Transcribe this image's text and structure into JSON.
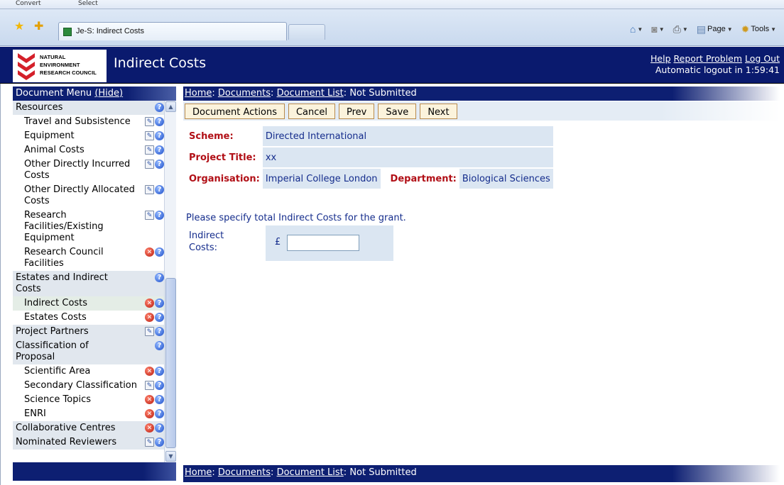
{
  "browser": {
    "top_strip": {
      "item1": "Convert",
      "item2": "Select"
    },
    "tab_title": "Je-S: Indirect Costs",
    "command_bar": {
      "page_label": "Page",
      "tools_label": "Tools"
    }
  },
  "header": {
    "logo_lines": [
      "NATURAL",
      "ENVIRONMENT",
      "RESEARCH COUNCIL"
    ],
    "title": "Indirect Costs",
    "links": {
      "help": "Help",
      "report": "Report Problem",
      "logout": "Log Out"
    },
    "logout_timer": "Automatic logout in 1:59:41"
  },
  "sidebar": {
    "title": "Document Menu",
    "hide_link": "(Hide)",
    "items": [
      {
        "label": "Resources",
        "type": "section",
        "icons": [
          "help"
        ]
      },
      {
        "label": "Travel and Subsistence",
        "type": "sub",
        "icons": [
          "edit",
          "help"
        ]
      },
      {
        "label": "Equipment",
        "type": "sub",
        "icons": [
          "edit",
          "help"
        ]
      },
      {
        "label": "Animal Costs",
        "type": "sub",
        "icons": [
          "edit",
          "help"
        ]
      },
      {
        "label": "Other Directly Incurred Costs",
        "type": "sub",
        "icons": [
          "edit",
          "help"
        ]
      },
      {
        "label": "Other Directly Allocated Costs",
        "type": "sub",
        "icons": [
          "edit",
          "help"
        ]
      },
      {
        "label": "Research Facilities/Existing Equipment",
        "type": "sub",
        "icons": [
          "edit",
          "help"
        ]
      },
      {
        "label": "Research Council Facilities",
        "type": "sub",
        "icons": [
          "error",
          "help"
        ]
      },
      {
        "label": "Estates and Indirect Costs",
        "type": "section",
        "icons": [
          "help"
        ]
      },
      {
        "label": "Indirect Costs",
        "type": "sub",
        "active": true,
        "icons": [
          "error",
          "help"
        ]
      },
      {
        "label": "Estates Costs",
        "type": "sub",
        "icons": [
          "error",
          "help"
        ]
      },
      {
        "label": "Project Partners",
        "type": "section",
        "icons": [
          "edit",
          "help"
        ]
      },
      {
        "label": "Classification of Proposal",
        "type": "section",
        "icons": [
          "help"
        ]
      },
      {
        "label": "Scientific Area",
        "type": "sub",
        "icons": [
          "error",
          "help"
        ]
      },
      {
        "label": "Secondary Classification",
        "type": "sub",
        "icons": [
          "edit",
          "help"
        ]
      },
      {
        "label": "Science Topics",
        "type": "sub",
        "icons": [
          "error",
          "help"
        ]
      },
      {
        "label": "ENRI",
        "type": "sub",
        "icons": [
          "error",
          "help"
        ]
      },
      {
        "label": "Collaborative Centres",
        "type": "section",
        "icons": [
          "error",
          "help"
        ]
      },
      {
        "label": "Nominated Reviewers",
        "type": "section",
        "icons": [
          "edit",
          "help"
        ]
      }
    ]
  },
  "breadcrumb": {
    "home": "Home",
    "documents": "Documents",
    "document_list": "Document List",
    "status": "Not Submitted",
    "sep": ":"
  },
  "actions": {
    "document_actions": "Document Actions",
    "cancel": "Cancel",
    "prev": "Prev",
    "save": "Save",
    "next": "Next"
  },
  "details": {
    "scheme_label": "Scheme:",
    "scheme_value": "Directed International",
    "project_title_label": "Project Title:",
    "project_title_value": "xx",
    "organisation_label": "Organisation:",
    "organisation_value": "Imperial College London",
    "department_label": "Department:",
    "department_value": "Biological Sciences"
  },
  "form": {
    "prompt": "Please specify total Indirect Costs for the grant.",
    "indirect_costs_label": "Indirect Costs:",
    "currency_symbol": "£",
    "indirect_costs_value": ""
  },
  "colors": {
    "header_bg": "#0a1a6e",
    "label_red": "#b10f16",
    "value_blue": "#142c8c",
    "value_bg": "#dbe6f2",
    "button_bg": "#fbf3dc"
  }
}
